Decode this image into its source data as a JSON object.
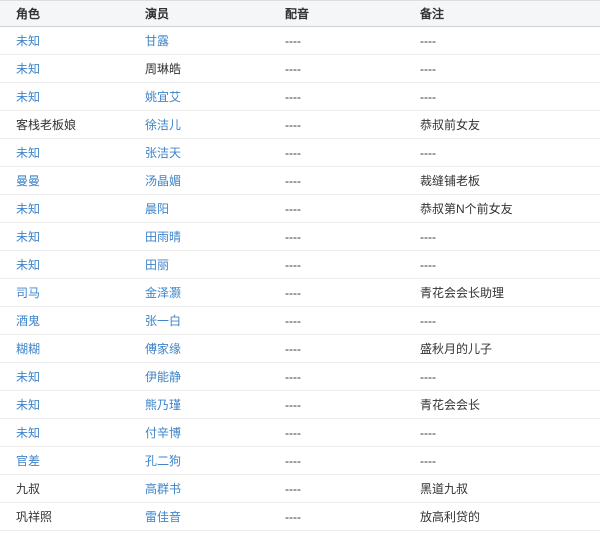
{
  "colors": {
    "link": "#3e84c9",
    "text": "#333333",
    "header_bg": "#f5f6f7",
    "header_border": "#ccd3d9",
    "row_border": "#ededed"
  },
  "table": {
    "columns": [
      {
        "label": "角色"
      },
      {
        "label": "演员"
      },
      {
        "label": "配音"
      },
      {
        "label": "备注"
      }
    ],
    "rows": [
      {
        "role": "未知",
        "role_link": true,
        "actor": "甘露",
        "actor_link": true,
        "dub": "----",
        "note": "----"
      },
      {
        "role": "未知",
        "role_link": true,
        "actor": "周琳皓",
        "actor_link": false,
        "dub": "----",
        "note": "----"
      },
      {
        "role": "未知",
        "role_link": true,
        "actor": "姚宜艾",
        "actor_link": true,
        "dub": "----",
        "note": "----"
      },
      {
        "role": "客栈老板娘",
        "role_link": false,
        "actor": "徐洁儿",
        "actor_link": true,
        "dub": "----",
        "note": "恭叔前女友"
      },
      {
        "role": "未知",
        "role_link": true,
        "actor": "张洁天",
        "actor_link": true,
        "dub": "----",
        "note": "----"
      },
      {
        "role": "曼曼",
        "role_link": true,
        "actor": "汤晶媚",
        "actor_link": true,
        "dub": "----",
        "note": "裁缝铺老板"
      },
      {
        "role": "未知",
        "role_link": true,
        "actor": "晨阳",
        "actor_link": true,
        "dub": "----",
        "note": "恭叔第N个前女友"
      },
      {
        "role": "未知",
        "role_link": true,
        "actor": "田雨晴",
        "actor_link": true,
        "dub": "----",
        "note": "----"
      },
      {
        "role": "未知",
        "role_link": true,
        "actor": "田丽",
        "actor_link": true,
        "dub": "----",
        "note": "----"
      },
      {
        "role": "司马",
        "role_link": true,
        "actor": "金泽灏",
        "actor_link": true,
        "dub": "----",
        "note": "青花会会长助理"
      },
      {
        "role": "酒鬼",
        "role_link": true,
        "actor": "张一白",
        "actor_link": true,
        "dub": "----",
        "note": "----"
      },
      {
        "role": "糊糊",
        "role_link": true,
        "actor": "傅家缘",
        "actor_link": true,
        "dub": "----",
        "note": "盛秋月的儿子"
      },
      {
        "role": "未知",
        "role_link": true,
        "actor": "伊能静",
        "actor_link": true,
        "dub": "----",
        "note": "----"
      },
      {
        "role": "未知",
        "role_link": true,
        "actor": "熊乃瑾",
        "actor_link": true,
        "dub": "----",
        "note": "青花会会长"
      },
      {
        "role": "未知",
        "role_link": true,
        "actor": "付辛博",
        "actor_link": true,
        "dub": "----",
        "note": "----"
      },
      {
        "role": "官差",
        "role_link": true,
        "actor": "孔二狗",
        "actor_link": true,
        "dub": "----",
        "note": "----"
      },
      {
        "role": "九叔",
        "role_link": false,
        "actor": "高群书",
        "actor_link": true,
        "dub": "----",
        "note": "黑道九叔"
      },
      {
        "role": "巩祥照",
        "role_link": false,
        "actor": "雷佳音",
        "actor_link": true,
        "dub": "----",
        "note": "放高利贷的"
      }
    ]
  }
}
